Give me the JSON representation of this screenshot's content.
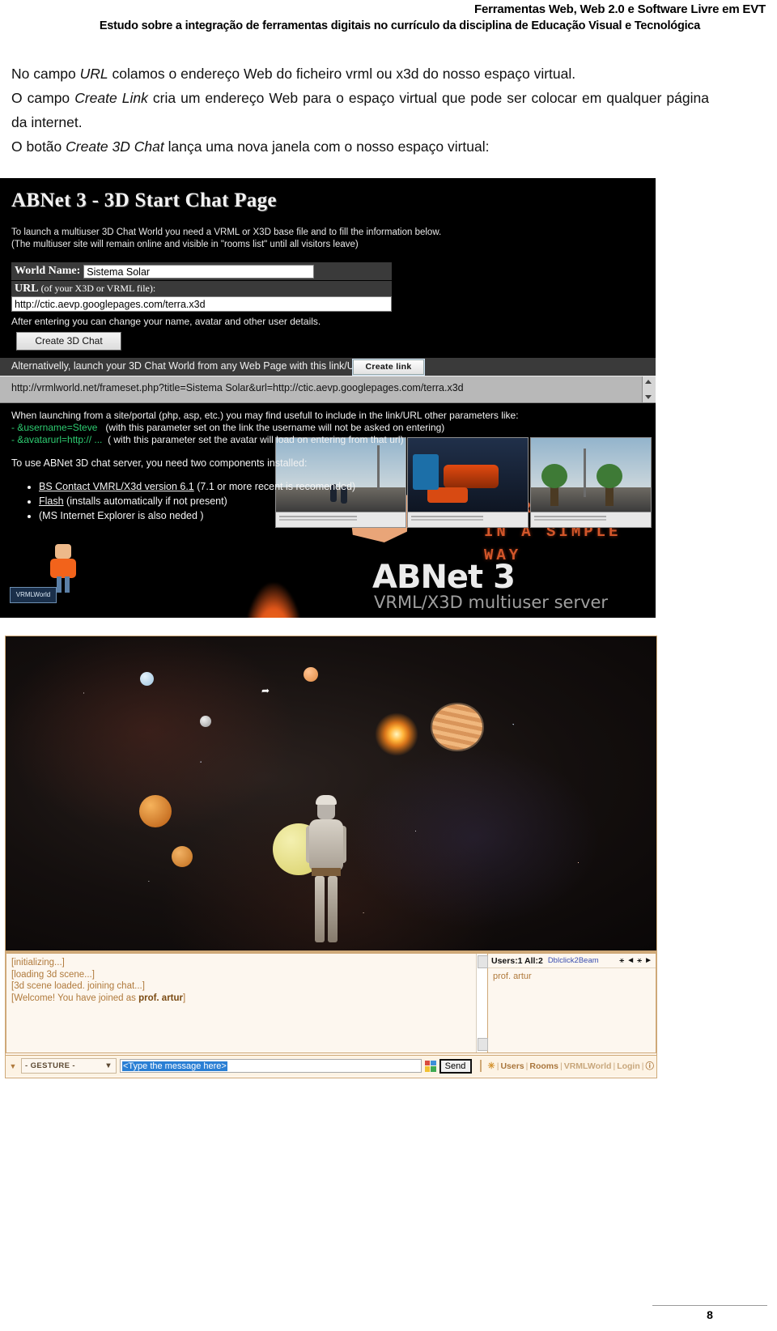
{
  "header": {
    "line1": "Ferramentas Web, Web 2.0 e Software Livre em EVT",
    "line2": "Estudo sobre a integração de ferramentas digitais no currículo da disciplina de Educação Visual e Tecnológica"
  },
  "body": {
    "p1_a": "No campo ",
    "p1_i": "URL",
    "p1_b": " colamos o endereço Web do ficheiro vrml ou x3d do nosso espaço virtual.",
    "p2_a": "O campo ",
    "p2_i": "Create Link",
    "p2_b": " cria um endereço Web para o espaço virtual que pode ser colocar em qualquer página da internet.",
    "p3_a": "O botão ",
    "p3_i": "Create 3D Chat",
    "p3_b": " lança uma nova janela com o nosso espaço virtual:"
  },
  "figure1": {
    "title": "ABNet 3 - 3D Start Chat Page",
    "lead_line1": "To launch a multiuser 3D Chat World you need a VRML or X3D base file and to fill the information below.",
    "lead_line2": "(The multiuser site will remain online and visible in \"rooms list\" until all visitors leave)",
    "world_name_label": "World Name:",
    "world_name_value": "Sistema Solar",
    "url_label_strong": "URL",
    "url_label_rest": " (of your X3D or VRML file):",
    "url_value": "http://ctic.aevp.googlepages.com/terra.x3d",
    "after_note": "After entering you can change your name, avatar and other user details.",
    "create_chat_button": "Create 3D Chat",
    "alternative_text": "Alternativelly, launch your 3D Chat World from any Web Page with this link/URL:",
    "create_link_button": "Create link",
    "generated_link": "http://vrmlworld.net/frameset.php?title=Sistema Solar&url=http://ctic.aevp.googlepages.com/terra.x3d",
    "launch_note": "When launching from a site/portal (php, asp, etc.) you may find usefull to include in the link/URL other parameters like:",
    "param1_name": "- &username=Steve",
    "param1_desc": "(with this parameter set on the link the username will not be asked on entering)",
    "param2_name": "- &avatarurl=http:// ...",
    "param2_desc": "( with this parameter set the avatar will load on entering from that url)",
    "use_note": "To use ABNet 3D chat server, you need two components installed:",
    "requirements": [
      {
        "link": "BS Contact VMRL/X3d version 6.1",
        "rest": " (7.1 or more recent is recomended)"
      },
      {
        "link": "Flash",
        "rest": " (installs automatically if not present)"
      },
      {
        "link": "",
        "rest": "(MS Internet Explorer is also neded )"
      }
    ],
    "share_line1": "SHARE YOUR 3D",
    "share_line2": "IN A SIMPLE WAY",
    "logo_text": "ABNet 3",
    "logo_sub": "VRML/X3D multiuser server",
    "badge_text": "VRMLWorld"
  },
  "figure2": {
    "chat_log": [
      {
        "text": "[initializing...]"
      },
      {
        "text": "[loading 3d scene...]"
      },
      {
        "text": "[3d scene loaded. joining chat...]"
      },
      {
        "prefix": "[Welcome! You have joined as ",
        "bold": "prof. artur",
        "suffix": "]"
      }
    ],
    "users_header": {
      "count_label": "Users:1 All:2",
      "dblclick_label": "Dblclick2Beam",
      "icons": [
        "person-icon",
        "left-arrow-icon",
        "person-icon",
        "right-arrow-icon"
      ]
    },
    "user_list": [
      "prof. artur"
    ],
    "bottom_bar": {
      "gesture_label": "- GESTURE -",
      "message_placeholder": "<Type the message here>",
      "send_label": "Send",
      "nav_links": [
        "Users",
        "Rooms",
        "VRMLWorld",
        "Login"
      ]
    }
  },
  "footer": {
    "page_number": "8"
  }
}
